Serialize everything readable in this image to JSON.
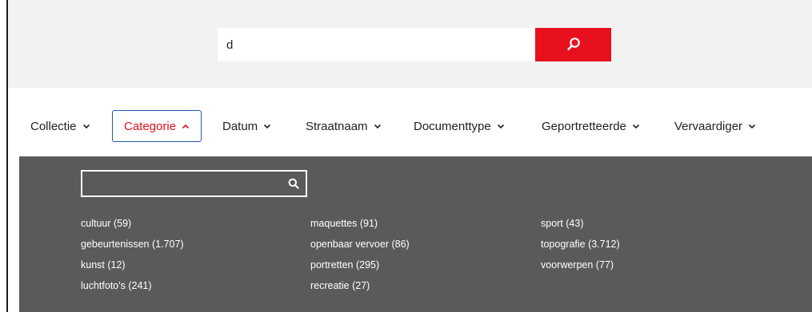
{
  "search": {
    "value": "d",
    "button_icon": "search-icon"
  },
  "filters": [
    {
      "label": "Collectie",
      "icon": "chevron-down-icon"
    },
    {
      "label": "Categorie",
      "icon": "chevron-up-icon"
    },
    {
      "label": "Datum",
      "icon": "chevron-down-icon"
    },
    {
      "label": "Straatnaam",
      "icon": "chevron-down-icon"
    },
    {
      "label": "Documenttype",
      "icon": "chevron-down-icon"
    },
    {
      "label": "Geportretteerde",
      "icon": "chevron-down-icon"
    },
    {
      "label": "Vervaardiger",
      "icon": "chevron-down-icon"
    }
  ],
  "panel": {
    "search_value": "",
    "columns": [
      [
        "cultuur (59)",
        "gebeurtenissen (1.707)",
        "kunst (12)",
        "luchtfoto's (241)"
      ],
      [
        "maquettes (91)",
        "openbaar vervoer (86)",
        "portretten (295)",
        "recreatie (27)"
      ],
      [
        "sport (43)",
        "topografie (3.712)",
        "voorwerpen (77)"
      ]
    ]
  },
  "colors": {
    "accent_red": "#e8101d",
    "active_border": "#1f5cab",
    "panel_bg": "#5a5a5a",
    "search_band_bg": "#f2f2f2"
  }
}
